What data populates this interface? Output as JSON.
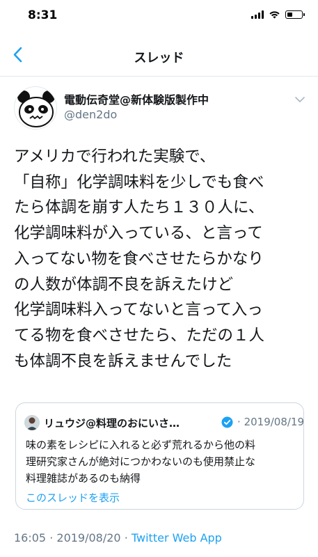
{
  "status_bar": {
    "time": "8:31",
    "icons": [
      "signal-icon",
      "wifi-icon",
      "battery-icon"
    ],
    "battery_level": 0.4
  },
  "nav": {
    "back_icon": "chevron-left-icon",
    "title": "スレッド"
  },
  "tweet": {
    "display_name": "電動伝奇堂@新体験版製作中",
    "handle": "@den2do",
    "lines": [
      "アメリカで行われた実験で、",
      "「自称」化学調味料を少しでも食べ",
      "たら体調を崩す人たち１３０人に、",
      "化学調味料が入っている、と言って",
      "入ってない物を食べさせたらかなり",
      "の人数が体調不良を訴えたけど",
      "化学調味料入ってないと言って入っ",
      "てる物を食べさせたら、ただの１人",
      "も体調不良を訴えませんでした"
    ],
    "time": "16:05",
    "separator": "·",
    "date": "2019/08/20",
    "source": "Twitter Web App"
  },
  "quote": {
    "display_name": "リュウジ@料理のおにいさ…",
    "date": "2019/08/19",
    "separator": "·",
    "lines": [
      "味の素をレシピに入れると必ず荒れるから他の料",
      "理研究家さんが絶対につかわないのも使用禁止な",
      "料理雑誌があるのも納得"
    ],
    "link": "このスレッドを表示"
  },
  "colors": {
    "accent": "#1da1f2",
    "secondary_text": "#657786",
    "primary_text": "#14171a",
    "border": "#ccd6dd"
  }
}
